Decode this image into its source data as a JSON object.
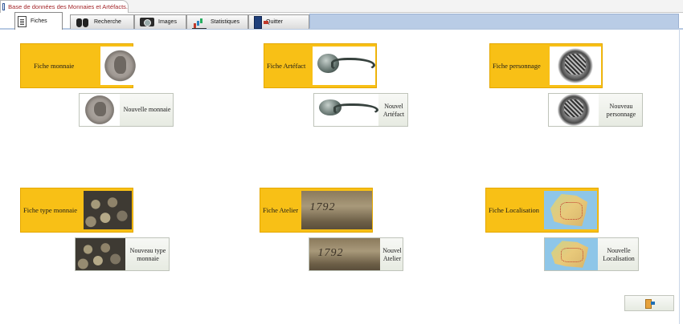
{
  "window": {
    "title": "Base de données des Monnaies et Artéfacts."
  },
  "tabs": [
    {
      "label": "Fiches",
      "icon": "document-list-icon",
      "active": true
    },
    {
      "label": "Recherche",
      "icon": "binoculars-icon",
      "active": false
    },
    {
      "label": "Images",
      "icon": "camera-icon",
      "active": false
    },
    {
      "label": "Statistiques",
      "icon": "bar-chart-icon",
      "active": false
    },
    {
      "label": "Quitter",
      "icon": "exit-door-icon",
      "active": false
    }
  ],
  "cards": {
    "monnaie": {
      "label": "Fiche monnaie",
      "new_label": "Nouvelle monnaie"
    },
    "artefact": {
      "label": "Fiche Artéfact",
      "new_label": "Nouvel Artéfact"
    },
    "personnage": {
      "label": "Fiche personnage",
      "new_label": "Nouveau personnage"
    },
    "type_monnaie": {
      "label": "Fiche type monnaie",
      "new_label": "Nouveau type monnaie"
    },
    "atelier": {
      "label": "Fiche Atelier",
      "new_label": "Nouvel Atelier"
    },
    "localisation": {
      "label": "Fiche Localisation",
      "new_label": "Nouvelle Localisation"
    }
  },
  "colors": {
    "card_background": "#f8c016",
    "title_text": "#a3262a",
    "tab_bar": "#b9cce6"
  },
  "close_button": {
    "icon": "exit-door-icon"
  }
}
